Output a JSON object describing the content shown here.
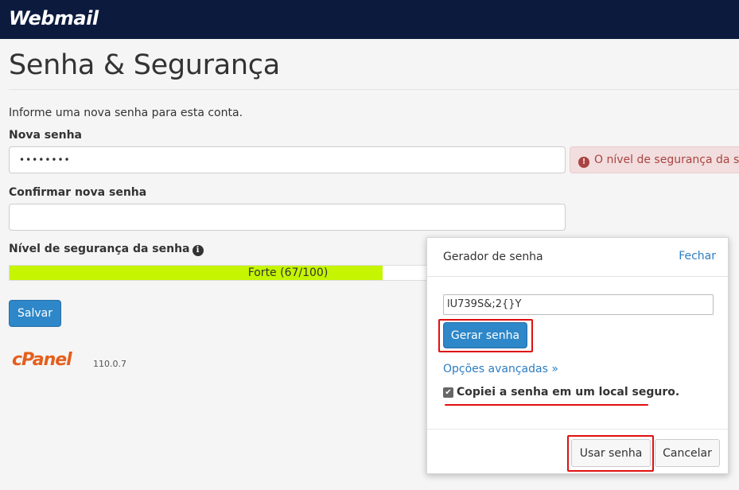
{
  "header": {
    "logo": "Webmail"
  },
  "page": {
    "title": "Senha & Segurança",
    "intro": "Informe uma nova senha para esta conta.",
    "new_password_label": "Nova senha",
    "new_password_value": "••••••••",
    "error_message": "O nível de segurança da senha",
    "confirm_password_label": "Confirmar nova senha",
    "confirm_password_value": "",
    "strength_label": "Nível de segurança da senha",
    "strength_text": "Forte (67/100)",
    "strength_value": 67,
    "strength_max": 100,
    "save_button": "Salvar"
  },
  "footer": {
    "brand": "cPanel",
    "version": "110.0.7"
  },
  "generator": {
    "title": "Gerador de senha",
    "close_label": "Fechar",
    "generated_password": "lU739S&;2{}Y",
    "generate_button": "Gerar senha",
    "advanced_link": "Opções avançadas »",
    "copied_checkbox_label": "Copiei a senha em um local seguro.",
    "copied_checked": true,
    "use_button": "Usar senha",
    "cancel_button": "Cancelar"
  },
  "colors": {
    "topbar": "#0c1a3e",
    "primary": "#2d87c8",
    "meter_fill": "#c5f500",
    "alert_bg": "#f2dede",
    "alert_text": "#a94442",
    "annotation_red": "#e01010",
    "link": "#2d7dc2",
    "cpanel_orange": "#e45f1c"
  },
  "icons": {
    "error": "exclamation-circle-icon",
    "info": "info-circle-icon",
    "check": "checkbox-checked-icon"
  }
}
